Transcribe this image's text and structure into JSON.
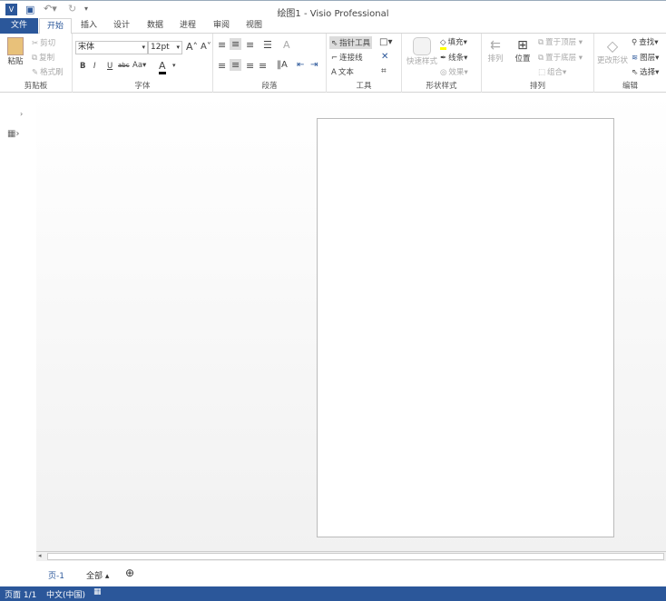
{
  "title": "绘图1 - Visio Professional",
  "tabs": [
    "文件",
    "开始",
    "插入",
    "设计",
    "数据",
    "进程",
    "审阅",
    "视图"
  ],
  "clipboard": {
    "paste": "粘贴",
    "cut": "剪切",
    "copy": "复制",
    "format_painter": "格式刷",
    "label": "剪贴板"
  },
  "font": {
    "name": "宋体",
    "size": "12pt",
    "label": "字体"
  },
  "paragraph": {
    "label": "段落"
  },
  "tools": {
    "pointer": "指针工具",
    "connector": "连接线",
    "text": "文本",
    "label": "工具"
  },
  "shape_styles": {
    "quick": "快速样式",
    "fill": "填充",
    "line": "线条",
    "effects": "效果",
    "label": "形状样式"
  },
  "arrange": {
    "arrange": "排列",
    "position": "位置",
    "bring_front": "置于顶层",
    "send_back": "置于底层",
    "group": "组合",
    "label": "排列"
  },
  "editing": {
    "change_shape": "更改形状",
    "find": "查找",
    "layers": "图层",
    "select": "选择",
    "label": "编辑"
  },
  "page_tabs": {
    "page": "页-1",
    "all": "全部"
  },
  "status": {
    "page": "页面 1/1",
    "lang": "中文(中国)"
  }
}
